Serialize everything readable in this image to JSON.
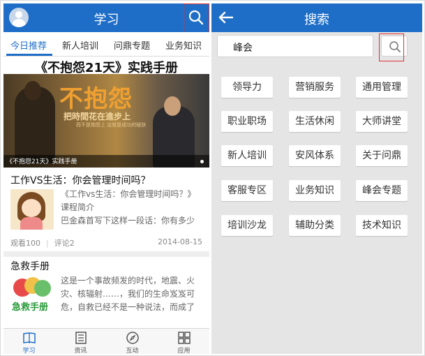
{
  "left": {
    "topbar": {
      "title": "学习"
    },
    "tabs": [
      {
        "label": "今日推荐",
        "active": true
      },
      {
        "label": "新人培训",
        "active": false
      },
      {
        "label": "问鼎专题",
        "active": false
      },
      {
        "label": "业务知识",
        "active": false
      }
    ],
    "banner": {
      "title": "《不抱怨21天》实践手册",
      "poster_text": "不抱怨",
      "poster_sub": "把時間花在進步上",
      "poster_sub2": "而不是抱怨上 這就是成功的秘訣",
      "caption": "《不抱怨21天》实践手册"
    },
    "articles": [
      {
        "title": "工作VS生活：你会管理时间吗？",
        "excerpt_lines": [
          "《工作vs生活：你会管理时间吗？》",
          "课程简介",
          "巴金森首写下这样一段话：你有多少"
        ],
        "views": "观看100",
        "comments": "评论2",
        "date": "2014-08-15"
      },
      {
        "title": "急救手册",
        "thumb_text": "急救手册",
        "excerpt_lines": [
          "这是一个事故频发的时代，地震、火",
          "灾、核辐射……，我们的生命岌岌可",
          "危，自救已经不是一种说法，而成了"
        ]
      }
    ],
    "bottom_nav": [
      {
        "label": "学习",
        "icon": "book-icon",
        "active": true
      },
      {
        "label": "资讯",
        "icon": "news-icon",
        "active": false
      },
      {
        "label": "互动",
        "icon": "compass-icon",
        "active": false
      },
      {
        "label": "应用",
        "icon": "apps-grid-icon",
        "active": false
      }
    ]
  },
  "right": {
    "topbar": {
      "title": "搜索"
    },
    "search": {
      "value": "峰会"
    },
    "tags": [
      "领导力",
      "营销服务",
      "通用管理",
      "职业职场",
      "生活休闲",
      "大师讲堂",
      "新人培训",
      "安风体系",
      "关于问鼎",
      "客服专区",
      "业务知识",
      "峰会专题",
      "培训沙龙",
      "辅助分类",
      "技术知识"
    ]
  },
  "colors": {
    "primary": "#1e6ec8",
    "highlight": "#e03030",
    "panel_bg": "#e5e5e5"
  }
}
